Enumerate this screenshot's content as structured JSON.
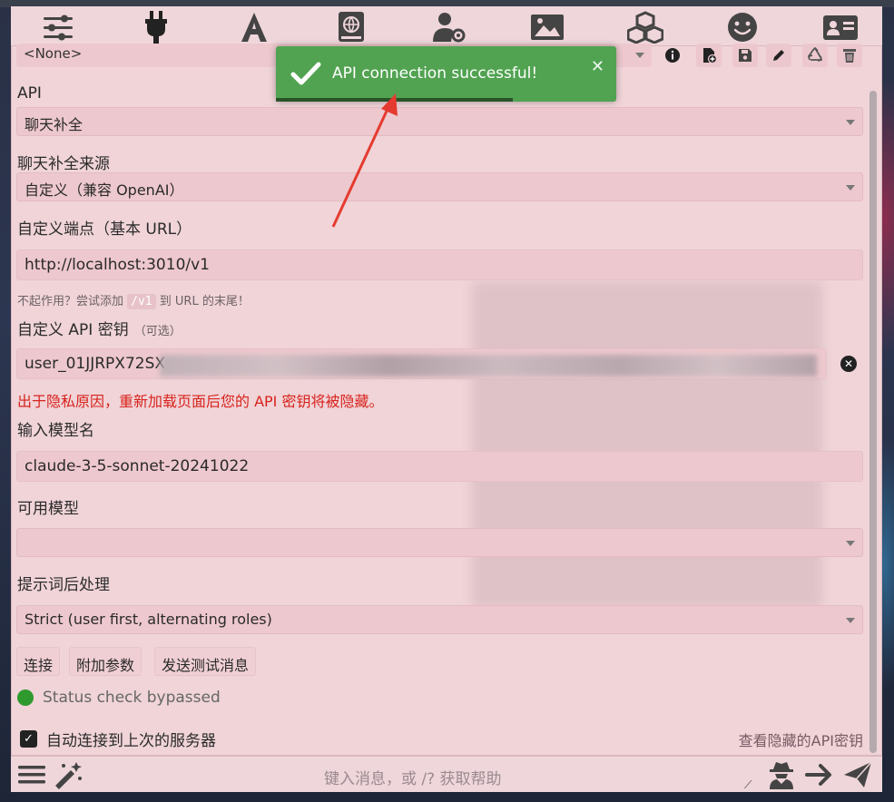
{
  "navbar": {
    "icons": [
      "sliders-icon",
      "plug-icon",
      "font-icon",
      "book-atlas-icon",
      "user-gear-icon",
      "image-icon",
      "cubes-icon",
      "face-smile-icon",
      "address-card-icon"
    ]
  },
  "preset": {
    "value": "<None>"
  },
  "toast": {
    "message": "API connection successful!",
    "close": "✕"
  },
  "api": {
    "label": "API",
    "value": "聊天补全"
  },
  "source": {
    "label": "聊天补全来源",
    "value": "自定义（兼容 OpenAI）"
  },
  "endpoint": {
    "label": "自定义端点（基本 URL）",
    "value": "http://localhost:3010/v1",
    "hint_before": "不起作用？尝试添加",
    "hint_code": "/v1",
    "hint_after": "到 URL 的末尾！"
  },
  "apikey": {
    "label": "自定义 API 密钥",
    "optional": "（可选）",
    "value": "user_01JJRPX72SX",
    "warning": "出于隐私原因，重新加载页面后您的 API 密钥将被隐藏。"
  },
  "model_input": {
    "label": "输入模型名",
    "value": "claude-3-5-sonnet-20241022"
  },
  "available_models": {
    "label": "可用模型",
    "value": ""
  },
  "postprocess": {
    "label": "提示词后处理",
    "value": "Strict (user first, alternating roles)"
  },
  "buttons": {
    "connect": "连接",
    "extra_params": "附加参数",
    "send_test": "发送测试消息"
  },
  "status": {
    "text": "Status check bypassed",
    "color": "#2e9a2e"
  },
  "autoconnect": {
    "label": "自动连接到上次的服务器",
    "checked": true
  },
  "view_keys_link": "查看隐藏的API密钥",
  "bottombar": {
    "placeholder": "键入消息，或 /? 获取帮助"
  },
  "colors": {
    "toast_bg": "#51a351",
    "warning": "#d8231c",
    "panel_bg": "#f0d4d8"
  }
}
